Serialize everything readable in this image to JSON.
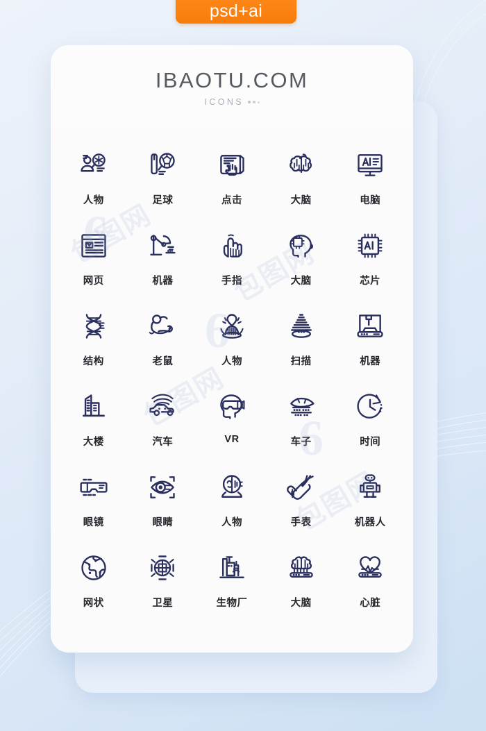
{
  "badge": {
    "label": "psd+ai",
    "color": "#f9820f"
  },
  "card": {
    "title": "IBAOTU.COM",
    "subtitle": "ICONS",
    "title_color": "#555a60",
    "subtitle_color": "#a9aeb4",
    "background": "#fdfdfe"
  },
  "icon_style": {
    "stroke_color": "#2a2f5e",
    "label_color": "#25262b"
  },
  "watermarks": [
    {
      "text": "包图网"
    },
    {
      "text": "包图网"
    },
    {
      "text": "包图网"
    },
    {
      "text": "包图网"
    },
    {
      "text": "6"
    },
    {
      "text": "6"
    },
    {
      "text": "6"
    }
  ],
  "grid": {
    "columns": 5,
    "rows": 6,
    "items": [
      {
        "label": "人物",
        "icon": "person-search-icon"
      },
      {
        "label": "足球",
        "icon": "football-search-icon"
      },
      {
        "label": "点击",
        "icon": "click-hand-icon"
      },
      {
        "label": "大脑",
        "icon": "brain-icon"
      },
      {
        "label": "电脑",
        "icon": "ai-monitor-icon"
      },
      {
        "label": "网页",
        "icon": "webpage-icon"
      },
      {
        "label": "机器",
        "icon": "robot-arm-icon"
      },
      {
        "label": "手指",
        "icon": "pointing-finger-icon"
      },
      {
        "label": "大脑",
        "icon": "head-circuit-icon"
      },
      {
        "label": "芯片",
        "icon": "ai-chip-icon"
      },
      {
        "label": "结构",
        "icon": "dna-structure-icon"
      },
      {
        "label": "老鼠",
        "icon": "lab-mouse-icon"
      },
      {
        "label": "人物",
        "icon": "person-hologram-icon"
      },
      {
        "label": "扫描",
        "icon": "scan-beam-icon"
      },
      {
        "label": "机器",
        "icon": "machine-printer-icon"
      },
      {
        "label": "大楼",
        "icon": "building-icon"
      },
      {
        "label": "汽车",
        "icon": "smart-car-icon"
      },
      {
        "label": "VR",
        "icon": "vr-headset-icon"
      },
      {
        "label": "车子",
        "icon": "hover-car-icon"
      },
      {
        "label": "时间",
        "icon": "clock-icon"
      },
      {
        "label": "眼镜",
        "icon": "smart-glasses-icon"
      },
      {
        "label": "眼睛",
        "icon": "eye-scan-icon"
      },
      {
        "label": "人物",
        "icon": "android-face-icon"
      },
      {
        "label": "手表",
        "icon": "hand-watch-icon"
      },
      {
        "label": "机器人",
        "icon": "robot-icon"
      },
      {
        "label": "网状",
        "icon": "network-globe-icon"
      },
      {
        "label": "卫星",
        "icon": "satellite-icon"
      },
      {
        "label": "生物厂",
        "icon": "bio-factory-icon"
      },
      {
        "label": "大脑",
        "icon": "brain-chip-icon"
      },
      {
        "label": "心脏",
        "icon": "heart-chip-icon"
      }
    ]
  }
}
